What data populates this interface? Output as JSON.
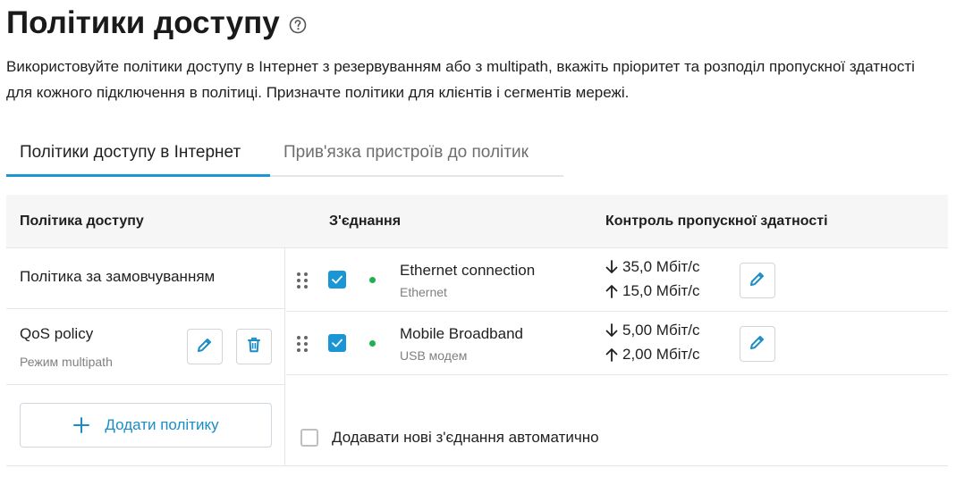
{
  "page": {
    "title": "Політики доступу",
    "description": "Використовуйте політики доступу в Інтернет з резервуванням або з multipath, вкажіть пріоритет та розподіл пропускної здатності для кожного підключення в політиці. Призначте політики для клієнтів і сегментів мережі."
  },
  "tabs": [
    {
      "label": "Політики доступу в Інтернет",
      "active": true
    },
    {
      "label": "Прив'язка пристроїв до політик",
      "active": false
    }
  ],
  "table": {
    "headers": {
      "policy": "Політика доступу",
      "connection": "З'єднання",
      "bandwidth": "Контроль пропускної здатності"
    },
    "policies": [
      {
        "name": "Політика за замовчуванням",
        "mode": ""
      },
      {
        "name": "QoS policy",
        "mode": "Режим multipath"
      }
    ],
    "add_policy_label": "Додати політику",
    "connections": [
      {
        "name": "Ethernet connection",
        "type": "Ethernet",
        "enabled": true,
        "status": "connected",
        "download": "35,0 Мбіт/с",
        "upload": "15,0 Мбіт/с"
      },
      {
        "name": "Mobile Broadband",
        "type": "USB модем",
        "enabled": true,
        "status": "connected",
        "download": "5,00 Мбіт/с",
        "upload": "2,00 Мбіт/с"
      }
    ],
    "auto_add_label": "Додавати нові з'єднання автоматично"
  },
  "colors": {
    "accent": "#1a96d4",
    "link": "#1a8cc8",
    "status_green": "#1fb04f"
  },
  "icons": [
    "help-icon",
    "edit-icon",
    "trash-icon",
    "plus-icon",
    "drag-handle-icon",
    "arrow-down-icon",
    "arrow-up-icon",
    "checkmark-icon"
  ]
}
